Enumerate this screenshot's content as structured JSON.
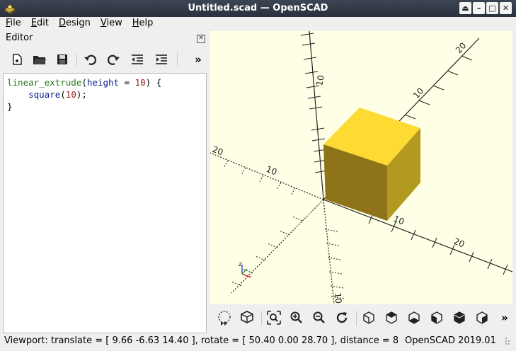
{
  "window": {
    "title": "Untitled.scad — OpenSCAD",
    "buttons": {
      "shade": "⏏",
      "minimize": "–",
      "maximize": "□",
      "close": "✕"
    }
  },
  "menubar": [
    {
      "label": "File",
      "mnemonic": "F"
    },
    {
      "label": "Edit",
      "mnemonic": "E"
    },
    {
      "label": "Design",
      "mnemonic": "D"
    },
    {
      "label": "View",
      "mnemonic": "V"
    },
    {
      "label": "Help",
      "mnemonic": "H"
    }
  ],
  "editor": {
    "title": "Editor",
    "close_glyph": "✕",
    "toolbar_icons": [
      "new-file-icon",
      "open-file-icon",
      "save-icon",
      "undo-icon",
      "redo-icon",
      "unindent-icon",
      "indent-icon"
    ],
    "overflow": "»",
    "code": {
      "line1": {
        "fn": "linear_extrude",
        "open": "(",
        "kw": "height",
        "eq": " = ",
        "num": "10",
        "close": ") {"
      },
      "line2": {
        "indent": "    ",
        "kw": "square",
        "open": "(",
        "num": "10",
        "close": ");"
      },
      "line3": "}"
    }
  },
  "viewport": {
    "background": "#ffffe5",
    "cube_colors": {
      "top": "#fddb32",
      "left": "#8e7319",
      "right": "#b19a1f"
    },
    "axis_labels": {
      "x_pos_near": "10",
      "x_pos_far": "20",
      "x_neg_near": "10",
      "x_neg_far": "20",
      "y_pos_near": "10",
      "y_pos_far": "20",
      "z_pos": "10",
      "z_neg": "10",
      "z_mark": "10"
    },
    "axis_gizmo": {
      "z": "z",
      "x": "x",
      "y": "y"
    }
  },
  "view_toolbar": {
    "icons": [
      "preview-icon",
      "render-icon",
      "zoom-all-icon",
      "zoom-in-icon",
      "zoom-out-icon",
      "reset-view-icon",
      "view-right-icon",
      "view-top-icon",
      "view-bottom-icon",
      "view-left-icon",
      "view-front-icon",
      "view-back-icon"
    ],
    "overflow": "»"
  },
  "status": {
    "viewport_text": "Viewport: translate = [ 9.66 -6.63 14.40 ], rotate = [ 50.40 0.00 28.70 ], distance = 8",
    "version": "OpenSCAD 2019.01"
  }
}
